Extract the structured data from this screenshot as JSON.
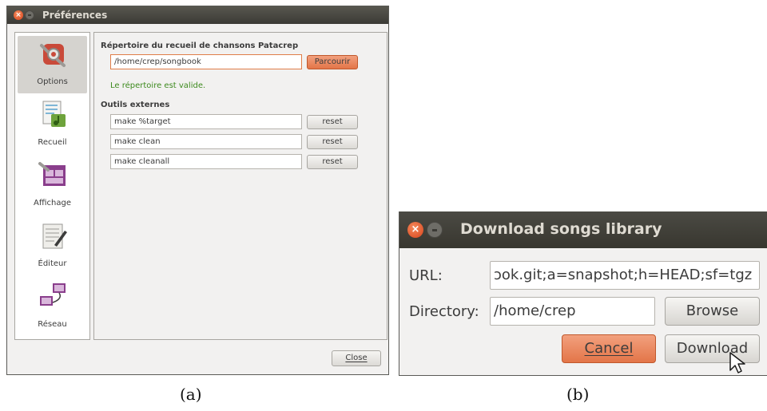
{
  "window_a": {
    "title": "Préférences",
    "sidebar": [
      {
        "label": "Options",
        "icon": "options-icon",
        "active": true
      },
      {
        "label": "Recueil",
        "icon": "songbook-icon",
        "active": false
      },
      {
        "label": "Affichage",
        "icon": "display-icon",
        "active": false
      },
      {
        "label": "Éditeur",
        "icon": "editor-icon",
        "active": false
      },
      {
        "label": "Réseau",
        "icon": "network-icon",
        "active": false
      }
    ],
    "songbook_section": {
      "heading": "Répertoire du recueil de chansons Patacrep",
      "path_value": "/home/crep/songbook",
      "browse_label": "Parcourir",
      "valid_message": "Le répertoire est valide."
    },
    "tools_section": {
      "heading": "Outils externes",
      "tools": [
        {
          "value": "make %target",
          "reset_label": "reset"
        },
        {
          "value": "make clean",
          "reset_label": "reset"
        },
        {
          "value": "make cleanall",
          "reset_label": "reset"
        }
      ]
    },
    "close_label": "Close",
    "caption": "(a)"
  },
  "window_b": {
    "title": "Download songs library",
    "url_label": "URL:",
    "url_value": "ɔok.git;a=snapshot;h=HEAD;sf=tgz",
    "directory_label": "Directory:",
    "directory_value": "/home/crep",
    "browse_label": "Browse",
    "cancel_label": "Cancel",
    "download_label": "Download",
    "caption": "(b)"
  },
  "colors": {
    "accent_orange": "#e37548",
    "titlebar_dark": "#3b3a35",
    "valid_green": "#3d8a1e",
    "window_bg": "#f2f1f0"
  }
}
